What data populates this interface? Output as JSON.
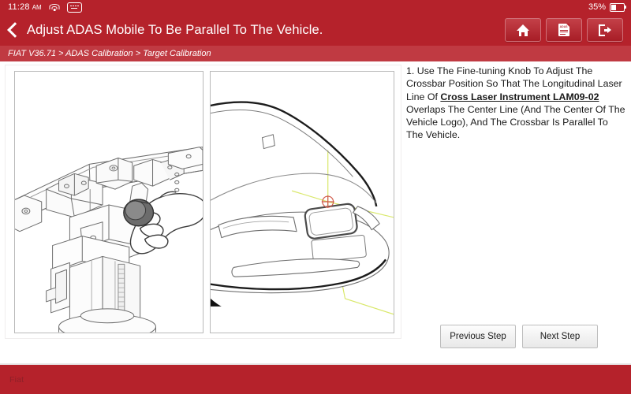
{
  "statusbar": {
    "time": "11:28",
    "ampm": "AM",
    "wifi_icon": "wifi-icon",
    "keyboard_icon": "keyboard-icon",
    "battery_percent": "35%",
    "battery_icon": "battery-low-icon"
  },
  "header": {
    "back_icon": "chevron-left-icon",
    "title": "Adjust ADAS Mobile To Be Parallel To The Vehicle.",
    "buttons": [
      {
        "name": "home-button",
        "icon": "home-icon"
      },
      {
        "name": "report-button",
        "icon": "document-adas-icon",
        "doc_label": "ADAS"
      },
      {
        "name": "exit-button",
        "icon": "exit-icon"
      }
    ]
  },
  "breadcrumb": {
    "text": "FIAT V36.71 > ADAS Calibration > Target Calibration"
  },
  "instruction": {
    "lead": "1. Use The Fine-tuning Knob To Adjust The Crossbar Position So That The Longitudinal Laser Line Of ",
    "emphasis": "Cross Laser Instrument LAM09-02",
    "tail": " Overlaps The Center Line (And The Center Of The Vehicle Logo), And The Crossbar Is Parallel To The Vehicle."
  },
  "images": {
    "left": {
      "name": "crossbar-knob-diagram",
      "alt": "Line drawing of ADAS crossbar rail with hand turning the fine-tuning knob on the vertical mast"
    },
    "right": {
      "name": "vehicle-laser-alignment-diagram",
      "alt": "Line drawing of vehicle front with laser lines crossing at the center of the vehicle logo"
    }
  },
  "navigation": {
    "previous_label": "Previous Step",
    "next_label": "Next Step"
  },
  "footer": {
    "brand": "Fiat"
  },
  "colors": {
    "brand_red": "#b5222b",
    "breadcrumb_red": "#c03a42",
    "laser_green": "#d9e86a",
    "target_red": "#d05a4a"
  }
}
